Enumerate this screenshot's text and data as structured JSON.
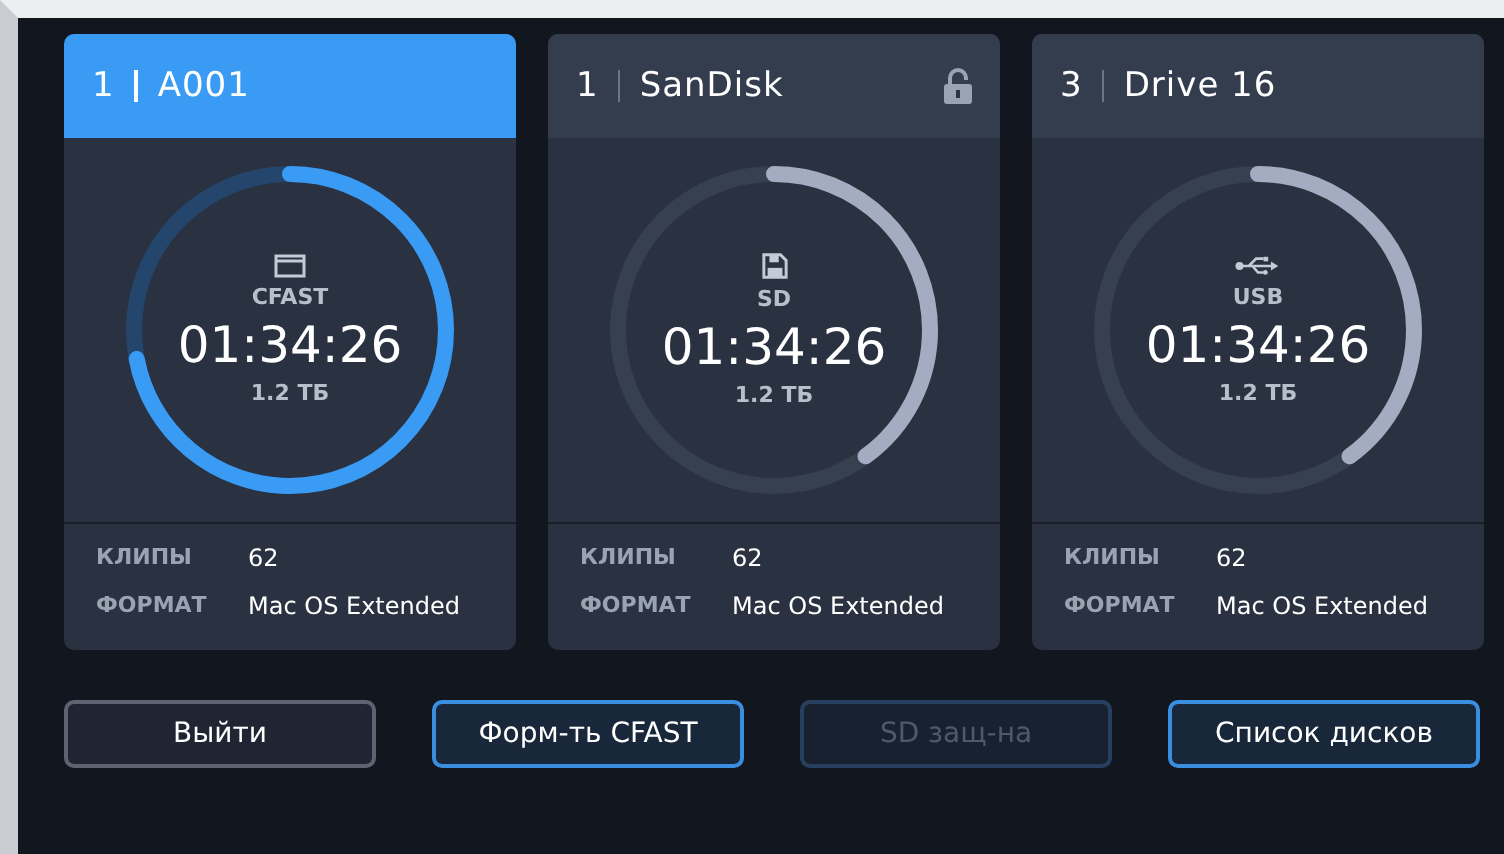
{
  "drives": [
    {
      "slot": "1",
      "name": "A001",
      "selected": true,
      "locked": false,
      "kind": "cfast",
      "media_label": "CFAST",
      "time": "01:34:26",
      "capacity": "1.2 ТБ",
      "level": 0.72,
      "clips_label": "КЛИПЫ",
      "clips": "62",
      "format_label": "ФОРМАТ",
      "format": "Mac OS Extended"
    },
    {
      "slot": "1",
      "name": "SanDisk",
      "selected": false,
      "locked": true,
      "kind": "sd",
      "media_label": "SD",
      "time": "01:34:26",
      "capacity": "1.2 ТБ",
      "level": 0.4,
      "clips_label": "КЛИПЫ",
      "clips": "62",
      "format_label": "ФОРМАТ",
      "format": "Mac OS Extended"
    },
    {
      "slot": "3",
      "name": "Drive 16",
      "selected": false,
      "locked": false,
      "kind": "usb",
      "media_label": "USB",
      "time": "01:34:26",
      "capacity": "1.2 ТБ",
      "level": 0.4,
      "clips_label": "КЛИПЫ",
      "clips": "62",
      "format_label": "ФОРМАТ",
      "format": "Mac OS Extended"
    }
  ],
  "buttons": [
    {
      "label": "Выйти",
      "kind": "plain",
      "disabled": false
    },
    {
      "label": "Форм-ть CFAST",
      "kind": "accent",
      "disabled": false
    },
    {
      "label": "SD защ-на",
      "kind": "accent",
      "disabled": true
    },
    {
      "label": "Список дисков",
      "kind": "accent",
      "disabled": false
    }
  ]
}
